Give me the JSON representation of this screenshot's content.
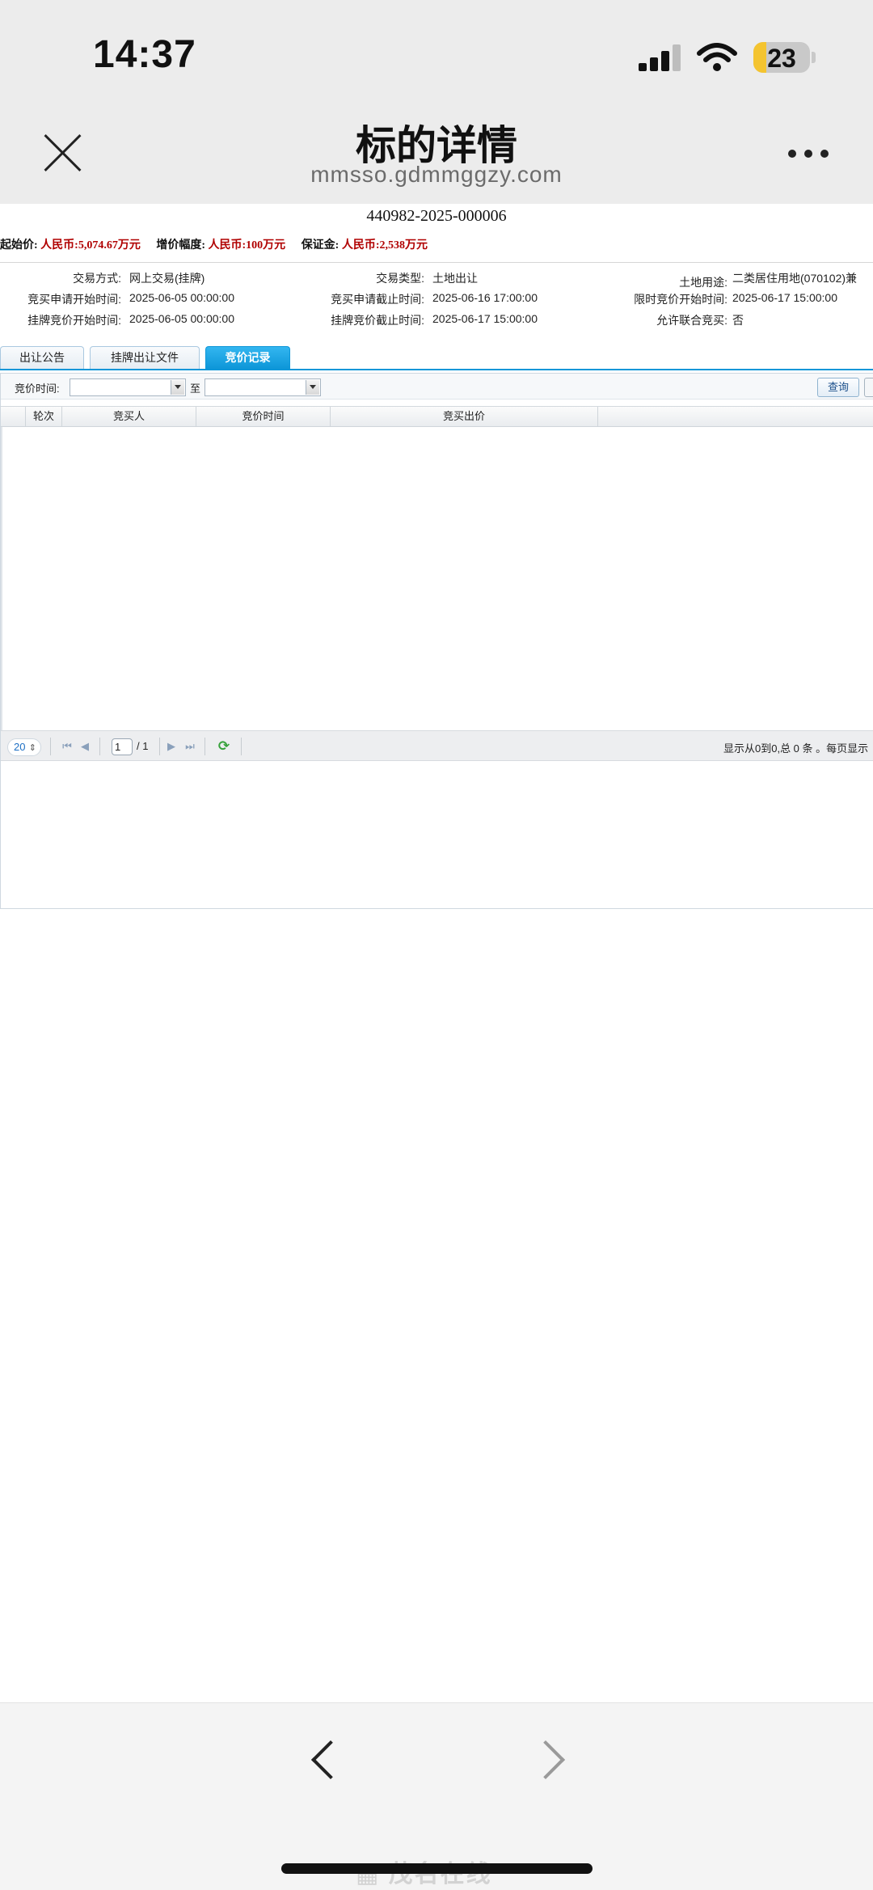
{
  "status_bar": {
    "time": "14:37",
    "battery_level": "23",
    "battery_fraction": 0.23
  },
  "header": {
    "title": "标的详情",
    "url": "mmsso.gdmmggzy.com"
  },
  "lot": {
    "number": "440982-2025-000006",
    "starting_price_label": "起始价:",
    "starting_price": "人民币:5,074.67万元",
    "increment_label": "增价幅度:",
    "increment": "人民币:100万元",
    "deposit_label": "保证金:",
    "deposit": "人民币:2,538万元"
  },
  "info": [
    {
      "label": "交易方式:",
      "value": "网上交易(挂牌)"
    },
    {
      "label": "交易类型:",
      "value": "土地出让"
    },
    {
      "label": "土地用途:",
      "value": "二类居住用地(070102)兼"
    },
    {
      "label": "竞买申请开始时间:",
      "value": "2025-06-05 00:00:00"
    },
    {
      "label": "竞买申请截止时间:",
      "value": "2025-06-16 17:00:00"
    },
    {
      "label": "限时竞价开始时间:",
      "value": "2025-06-17 15:00:00"
    },
    {
      "label": "挂牌竞价开始时间:",
      "value": "2025-06-05 00:00:00"
    },
    {
      "label": "挂牌竞价截止时间:",
      "value": "2025-06-17 15:00:00"
    },
    {
      "label": "允许联合竞买:",
      "value": "否"
    }
  ],
  "tabs": [
    {
      "label": "出让公告",
      "active": false
    },
    {
      "label": "挂牌出让文件",
      "active": false
    },
    {
      "label": "竞价记录",
      "active": true
    }
  ],
  "filter": {
    "time_label": "竞价时间:",
    "to_label": "至",
    "start_value": "",
    "end_value": "",
    "query_button": "查询"
  },
  "table": {
    "columns": [
      "轮次",
      "竞买人",
      "竞价时间",
      "竞买出价"
    ],
    "rows": []
  },
  "pager": {
    "page_size": "20",
    "current_page": "1",
    "total_pages": "/ 1",
    "info": "显示从0到0,总 0 条 。每页显示"
  },
  "watermark": "茂名在线"
}
